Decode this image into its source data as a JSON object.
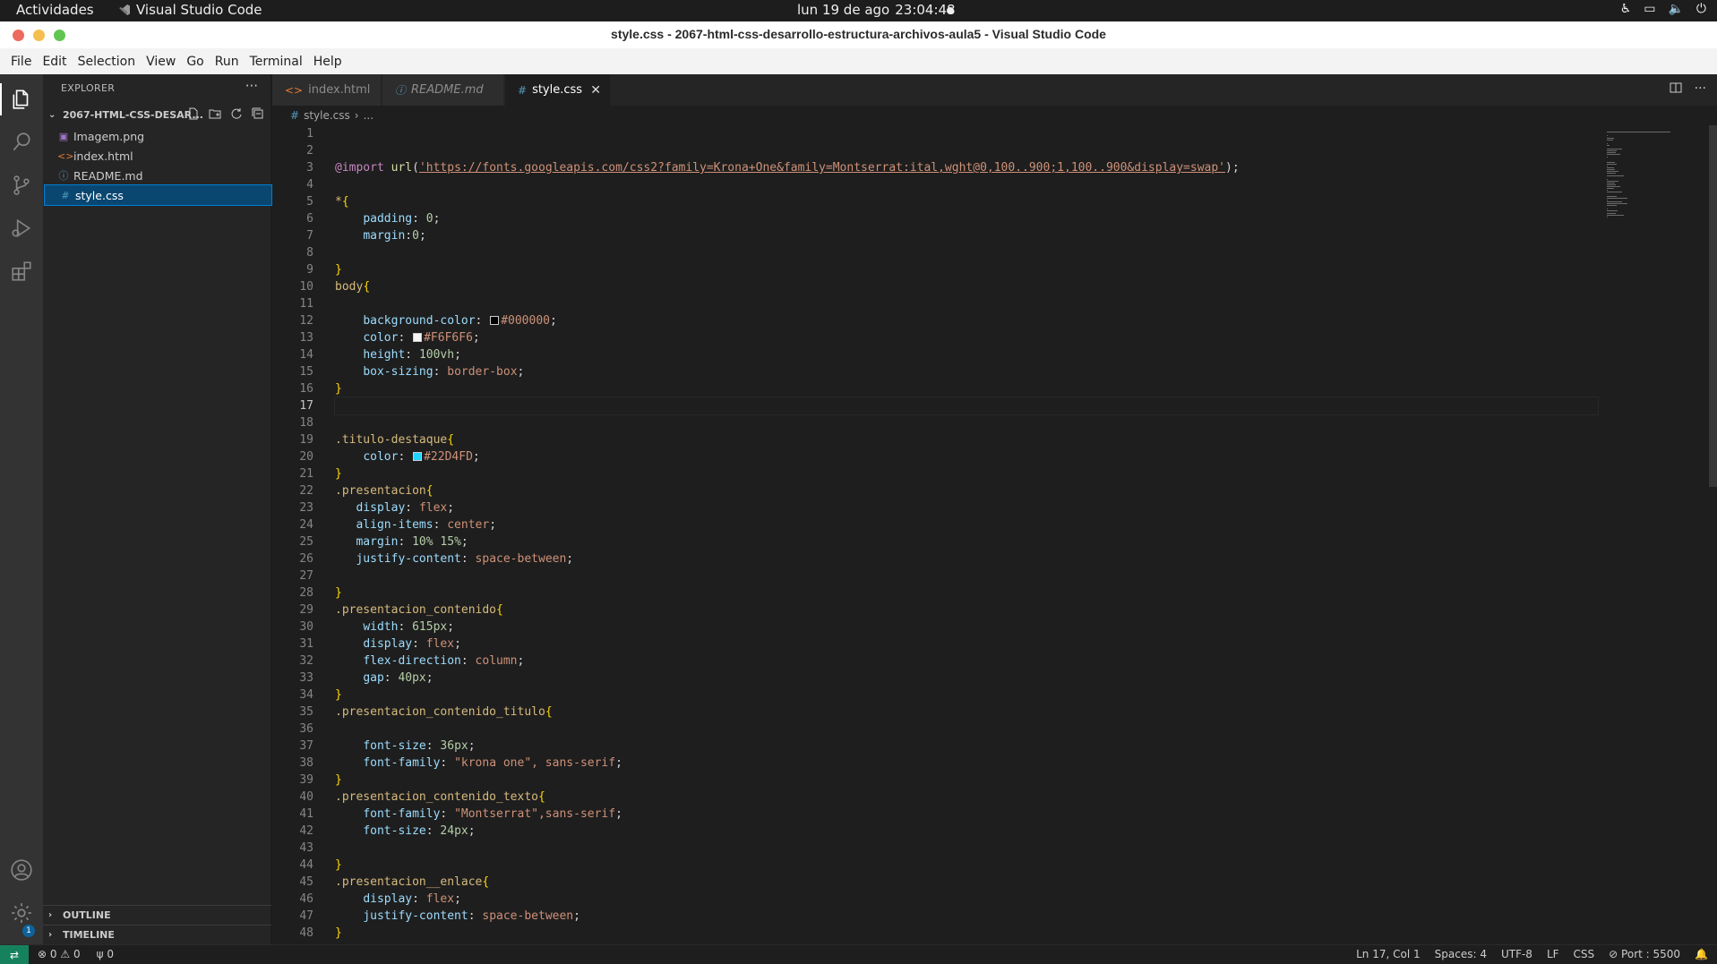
{
  "system_bar": {
    "activities": "Actividades",
    "app_name": "Visual Studio Code",
    "date": "lun 19 de ago",
    "time": "23:04:48"
  },
  "window": {
    "title": "style.css - 2067-html-css-desarrollo-estructura-archivos-aula5 - Visual Studio Code",
    "colors": {
      "close": "#ed6a5e",
      "minimize": "#f5bf4f",
      "maximize": "#61c554"
    }
  },
  "menu": [
    "File",
    "Edit",
    "Selection",
    "View",
    "Go",
    "Run",
    "Terminal",
    "Help"
  ],
  "activity_bar": {
    "items": [
      "explorer-icon",
      "search-icon",
      "source-control-icon",
      "run-debug-icon",
      "extensions-icon"
    ],
    "bottom": [
      "account-icon",
      "settings-gear-icon"
    ],
    "settings_badge": "1"
  },
  "sidebar": {
    "header": "EXPLORER",
    "more": "···",
    "folder": "2067-HTML-CSS-DESAR...",
    "files": [
      {
        "name": "Imagem.png",
        "icon": "image-file-icon",
        "glyph": "▣",
        "color": "#a074c4"
      },
      {
        "name": "index.html",
        "icon": "html-file-icon",
        "glyph": "<>",
        "color": "#e37933"
      },
      {
        "name": "README.md",
        "icon": "info-file-icon",
        "glyph": "ⓘ",
        "color": "#519aba"
      },
      {
        "name": "style.css",
        "icon": "css-file-icon",
        "glyph": "#",
        "color": "#519aba",
        "selected": true
      }
    ],
    "outline": "OUTLINE",
    "timeline": "TIMELINE"
  },
  "tabs": [
    {
      "label": "index.html",
      "icon": "<>",
      "icon_color": "#e37933"
    },
    {
      "label": "README.md",
      "icon": "ⓘ",
      "icon_color": "#519aba"
    },
    {
      "label": "style.css",
      "icon": "#",
      "icon_color": "#519aba",
      "active": true,
      "close": "✕"
    }
  ],
  "breadcrumb": {
    "file": "style.css",
    "separator": "›",
    "rest": "..."
  },
  "editor": {
    "current_line": 17,
    "lines": [
      [],
      [],
      [
        [
          "at",
          "@import"
        ],
        [
          "pn",
          " "
        ],
        [
          "fn",
          "url"
        ],
        [
          "pn",
          "("
        ],
        [
          "str",
          "'https://fonts.googleapis.com/css2?family=Krona+One&family=Montserrat:ital,wght@0,100..900;1,100..900&display=swap'"
        ],
        [
          "pn",
          ");"
        ]
      ],
      [],
      [
        [
          "sel",
          "*"
        ],
        [
          "br",
          "{"
        ]
      ],
      [
        [
          "pn",
          "    "
        ],
        [
          "prop",
          "padding"
        ],
        [
          "pn",
          ": "
        ],
        [
          "num",
          "0"
        ],
        [
          "pn",
          ";"
        ]
      ],
      [
        [
          "pn",
          "    "
        ],
        [
          "prop",
          "margin"
        ],
        [
          "pn",
          ":"
        ],
        [
          "num",
          "0"
        ],
        [
          "pn",
          ";"
        ]
      ],
      [],
      [
        [
          "br",
          "}"
        ]
      ],
      [
        [
          "sel",
          "body"
        ],
        [
          "br",
          "{"
        ]
      ],
      [],
      [
        [
          "pn",
          "    "
        ],
        [
          "prop",
          "background-color"
        ],
        [
          "pn",
          ": "
        ],
        [
          "swatch",
          "#000000"
        ],
        [
          "val",
          "#000000"
        ],
        [
          "pn",
          ";"
        ]
      ],
      [
        [
          "pn",
          "    "
        ],
        [
          "prop",
          "color"
        ],
        [
          "pn",
          ": "
        ],
        [
          "swatch",
          "#F6F6F6"
        ],
        [
          "val",
          "#F6F6F6"
        ],
        [
          "pn",
          ";"
        ]
      ],
      [
        [
          "pn",
          "    "
        ],
        [
          "prop",
          "height"
        ],
        [
          "pn",
          ": "
        ],
        [
          "num",
          "100vh"
        ],
        [
          "pn",
          ";"
        ]
      ],
      [
        [
          "pn",
          "    "
        ],
        [
          "prop",
          "box-sizing"
        ],
        [
          "pn",
          ": "
        ],
        [
          "val",
          "border-box"
        ],
        [
          "pn",
          ";"
        ]
      ],
      [
        [
          "br",
          "}"
        ]
      ],
      [],
      [],
      [
        [
          "sel",
          ".titulo-destaque"
        ],
        [
          "br",
          "{"
        ]
      ],
      [
        [
          "pn",
          "    "
        ],
        [
          "prop",
          "color"
        ],
        [
          "pn",
          ": "
        ],
        [
          "swatch",
          "#22D4FD"
        ],
        [
          "val",
          "#22D4FD"
        ],
        [
          "pn",
          ";"
        ]
      ],
      [
        [
          "br",
          "}"
        ]
      ],
      [
        [
          "sel",
          ".presentacion"
        ],
        [
          "br",
          "{"
        ]
      ],
      [
        [
          "pn",
          "   "
        ],
        [
          "prop",
          "display"
        ],
        [
          "pn",
          ": "
        ],
        [
          "val",
          "flex"
        ],
        [
          "pn",
          ";"
        ]
      ],
      [
        [
          "pn",
          "   "
        ],
        [
          "prop",
          "align-items"
        ],
        [
          "pn",
          ": "
        ],
        [
          "val",
          "center"
        ],
        [
          "pn",
          ";"
        ]
      ],
      [
        [
          "pn",
          "   "
        ],
        [
          "prop",
          "margin"
        ],
        [
          "pn",
          ": "
        ],
        [
          "num",
          "10% 15%"
        ],
        [
          "pn",
          ";"
        ]
      ],
      [
        [
          "pn",
          "   "
        ],
        [
          "prop",
          "justify-content"
        ],
        [
          "pn",
          ": "
        ],
        [
          "val",
          "space-between"
        ],
        [
          "pn",
          ";"
        ]
      ],
      [],
      [
        [
          "br",
          "}"
        ]
      ],
      [
        [
          "sel",
          ".presentacion_contenido"
        ],
        [
          "br",
          "{"
        ]
      ],
      [
        [
          "pn",
          "    "
        ],
        [
          "prop",
          "width"
        ],
        [
          "pn",
          ": "
        ],
        [
          "num",
          "615px"
        ],
        [
          "pn",
          ";"
        ]
      ],
      [
        [
          "pn",
          "    "
        ],
        [
          "prop",
          "display"
        ],
        [
          "pn",
          ": "
        ],
        [
          "val",
          "flex"
        ],
        [
          "pn",
          ";"
        ]
      ],
      [
        [
          "pn",
          "    "
        ],
        [
          "prop",
          "flex-direction"
        ],
        [
          "pn",
          ": "
        ],
        [
          "val",
          "column"
        ],
        [
          "pn",
          ";"
        ]
      ],
      [
        [
          "pn",
          "    "
        ],
        [
          "prop",
          "gap"
        ],
        [
          "pn",
          ": "
        ],
        [
          "num",
          "40px"
        ],
        [
          "pn",
          ";"
        ]
      ],
      [
        [
          "br",
          "}"
        ]
      ],
      [
        [
          "sel",
          ".presentacion_contenido_titulo"
        ],
        [
          "br",
          "{"
        ]
      ],
      [],
      [
        [
          "pn",
          "    "
        ],
        [
          "prop",
          "font-size"
        ],
        [
          "pn",
          ": "
        ],
        [
          "num",
          "36px"
        ],
        [
          "pn",
          ";"
        ]
      ],
      [
        [
          "pn",
          "    "
        ],
        [
          "prop",
          "font-family"
        ],
        [
          "pn",
          ": "
        ],
        [
          "val",
          "\"krona one\", sans-serif"
        ],
        [
          "pn",
          ";"
        ]
      ],
      [
        [
          "br",
          "}"
        ]
      ],
      [
        [
          "sel",
          ".presentacion_contenido_texto"
        ],
        [
          "br",
          "{"
        ]
      ],
      [
        [
          "pn",
          "    "
        ],
        [
          "prop",
          "font-family"
        ],
        [
          "pn",
          ": "
        ],
        [
          "val",
          "\"Montserrat\",sans-serif"
        ],
        [
          "pn",
          ";"
        ]
      ],
      [
        [
          "pn",
          "    "
        ],
        [
          "prop",
          "font-size"
        ],
        [
          "pn",
          ": "
        ],
        [
          "num",
          "24px"
        ],
        [
          "pn",
          ";"
        ]
      ],
      [],
      [
        [
          "br",
          "}"
        ]
      ],
      [
        [
          "sel",
          ".presentacion__enlace"
        ],
        [
          "br",
          "{"
        ]
      ],
      [
        [
          "pn",
          "    "
        ],
        [
          "prop",
          "display"
        ],
        [
          "pn",
          ": "
        ],
        [
          "val",
          "flex"
        ],
        [
          "pn",
          ";"
        ]
      ],
      [
        [
          "pn",
          "    "
        ],
        [
          "prop",
          "justify-content"
        ],
        [
          "pn",
          ": "
        ],
        [
          "val",
          "space-between"
        ],
        [
          "pn",
          ";"
        ]
      ],
      [
        [
          "br",
          "}"
        ]
      ]
    ]
  },
  "status_bar": {
    "errors": "0",
    "warnings": "0",
    "ports": "0",
    "cursor": "Ln 17, Col 1",
    "indent": "Spaces: 4",
    "encoding": "UTF-8",
    "eol": "LF",
    "language": "CSS",
    "port": "Port : 5500"
  }
}
